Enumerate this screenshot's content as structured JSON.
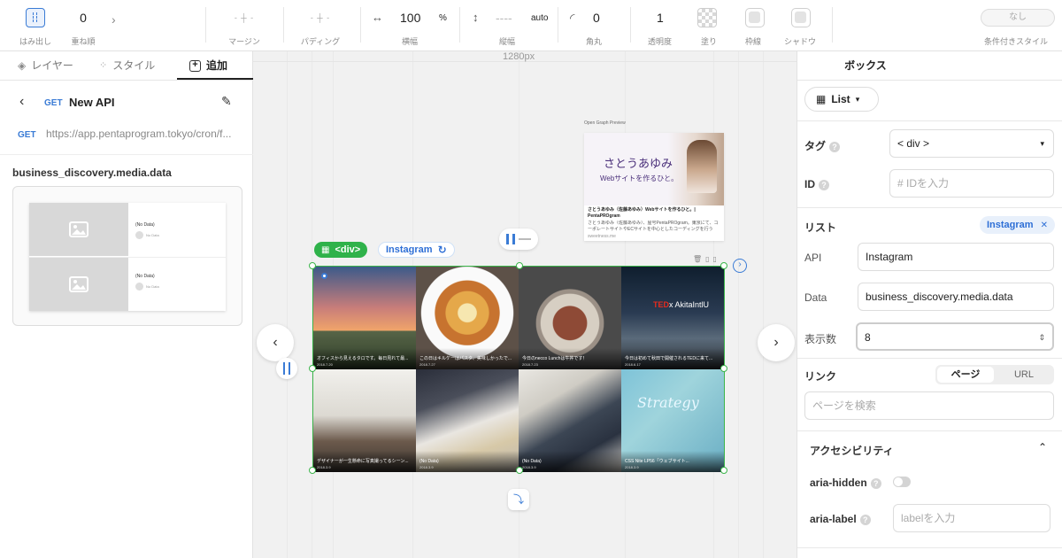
{
  "toolbar": {
    "hamidashi": "はみ出し",
    "z_value": "0",
    "z_label": "重ね順",
    "margin_label": "マージン",
    "padding_label": "パディング",
    "width_value": "100",
    "width_unit": "%",
    "width_label": "横幅",
    "height_value": "----",
    "height_unit": "auto",
    "height_label": "縦幅",
    "radius_value": "0",
    "radius_label": "角丸",
    "opacity_value": "1",
    "opacity_label": "透明度",
    "fill_label": "塗り",
    "border_label": "枠線",
    "shadow_label": "シャドウ",
    "conditional_value": "なし",
    "conditional_label": "条件付きスタイル"
  },
  "left": {
    "tabs": [
      "レイヤー",
      "スタイル",
      "追加"
    ],
    "api_method": "GET",
    "api_name": "New API",
    "url_method": "GET",
    "url": "https://app.pentaprogram.tokyo/cron/f...",
    "data_path": "business_discovery.media.data",
    "preview_text": "(No Data)",
    "preview_sub": "No Data"
  },
  "canvas": {
    "ruler": "1280px",
    "og_title": "Open Graph Preview",
    "og_name": "さとうあゆみ",
    "og_sub": "Webサイトを作るひと。",
    "og_head": "さとうあゆみ（佐藤あゆみ）Webサイトを作るひと。| PentaPROgram",
    "og_desc": "さとうあゆみ（佐藤あゆみ）、屋号PentaPROgram。東京にて、コーポレートサイトやECサイトを中心としたコーディングを行う",
    "og_domain": "sweetness.me",
    "div_tag": "<div>",
    "instagram_tag": "Instagram",
    "cells": [
      {
        "title": "オフィスから見えるタロです。毎日見れて最...",
        "date": "2018.7.20"
      },
      {
        "title": "この日はキルケーはパスタ、美味しかったで...",
        "date": "2018.7.27"
      },
      {
        "title": "今日のnecco Lunchは牛丼です！",
        "date": "2018.7.23"
      },
      {
        "title": "今日は初めて秋田で開催されるTEDに来て...",
        "date": "2018.6.17"
      },
      {
        "title": "デザイナーが一生懸命に写真撮ってるシーン...",
        "date": "2018.3.9"
      },
      {
        "title": "(No Data)",
        "date": "2018.3.9"
      },
      {
        "title": "(No Data)",
        "date": "2018.3.9"
      },
      {
        "title": "CSS Nite LP56「ウェブサイト...",
        "date": "2018.3.9"
      }
    ]
  },
  "right": {
    "tab": "ボックス",
    "view_select": "List",
    "tag_label": "タグ",
    "tag_value": "< div >",
    "id_label": "ID",
    "id_placeholder": "IDを入力",
    "list_label": "リスト",
    "list_chip": "Instagram",
    "api_label": "API",
    "api_value": "Instagram",
    "data_label": "Data",
    "data_value": "business_discovery.media.data",
    "count_label": "表示数",
    "count_value": "8",
    "link_label": "リンク",
    "link_tabs": [
      "ページ",
      "URL"
    ],
    "link_placeholder": "ページを検索",
    "a11y_label": "アクセシビリティ",
    "aria_hidden_label": "aria-hidden",
    "aria_label_label": "aria-label",
    "aria_label_placeholder": "labelを入力"
  }
}
